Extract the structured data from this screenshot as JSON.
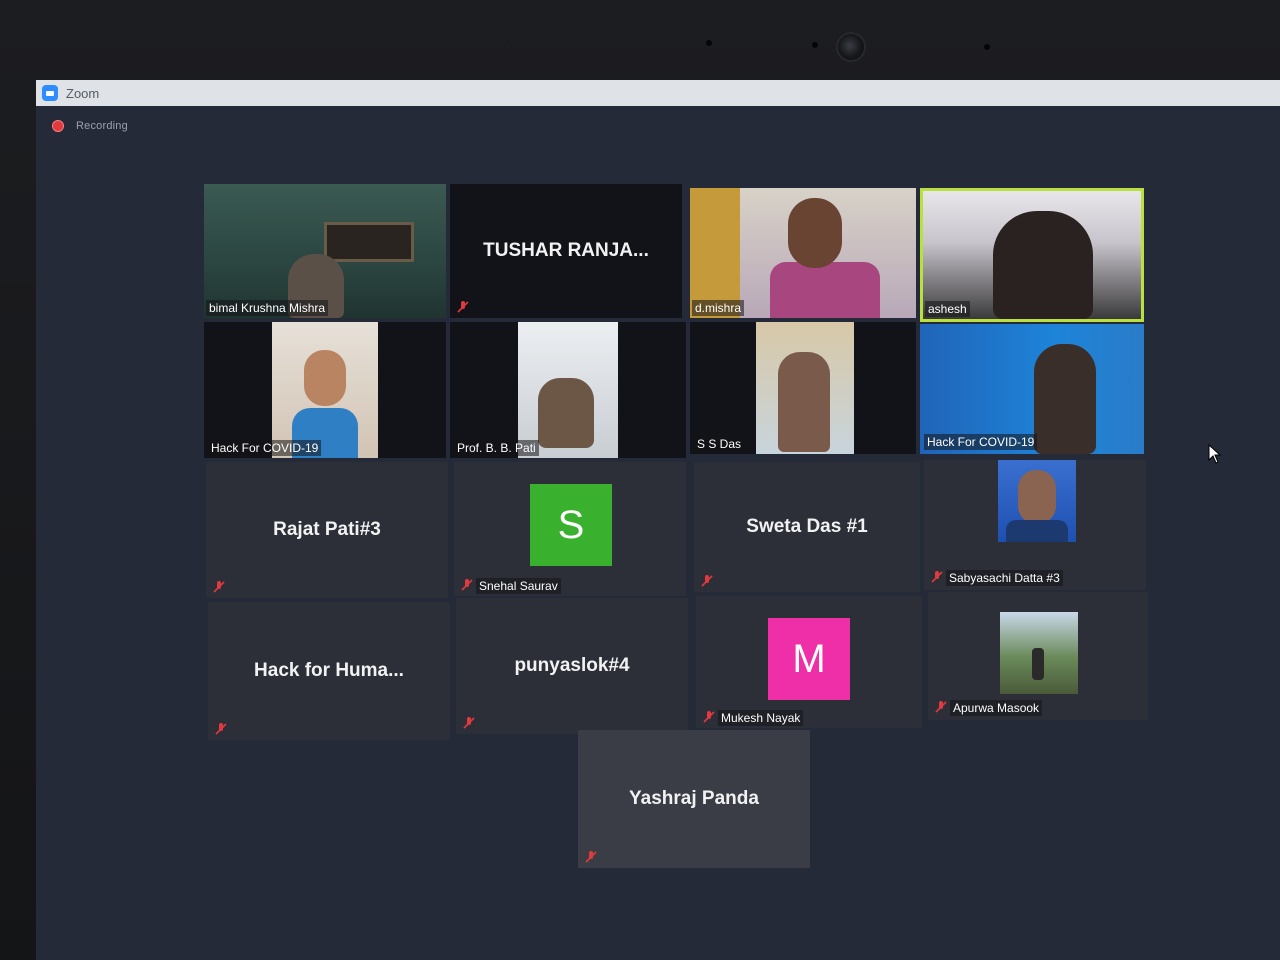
{
  "window": {
    "title": "Zoom"
  },
  "recording": {
    "label": "Recording"
  },
  "colors": {
    "active_speaker": "#b7e040",
    "avatar_s": "#3ab12e",
    "avatar_m": "#ee2fa8",
    "muted": "#e0393e"
  },
  "participants": [
    {
      "name": "bimal Krushna Mishra",
      "video": true,
      "muted": false
    },
    {
      "name": "TUSHAR  RANJA...",
      "video": false,
      "muted": true
    },
    {
      "name": "d.mishra",
      "video": true,
      "muted": false
    },
    {
      "name": "ashesh",
      "video": true,
      "muted": false,
      "active": true
    },
    {
      "name": "Hack For COVID-19",
      "video": true,
      "muted": false
    },
    {
      "name": "Prof. B. B. Pati",
      "video": true,
      "muted": false
    },
    {
      "name": "S S Das",
      "video": true,
      "muted": false
    },
    {
      "name": "Hack For COVID-19",
      "video": true,
      "muted": false
    },
    {
      "name": "Rajat Pati#3",
      "video": false,
      "muted": true
    },
    {
      "name": "Snehal Saurav",
      "avatar": "S",
      "muted": true
    },
    {
      "name": "Sweta Das #1",
      "video": false,
      "muted": true
    },
    {
      "name": "Sabyasachi Datta #3",
      "video": true,
      "muted": true
    },
    {
      "name": "Hack for Huma...",
      "video": false,
      "muted": true
    },
    {
      "name": "punyaslok#4",
      "video": false,
      "muted": true
    },
    {
      "name": "Mukesh Nayak",
      "avatar": "M",
      "muted": true
    },
    {
      "name": "Apurwa Masook",
      "video": true,
      "muted": true
    },
    {
      "name": "Yashraj Panda",
      "video": false,
      "muted": true
    }
  ]
}
